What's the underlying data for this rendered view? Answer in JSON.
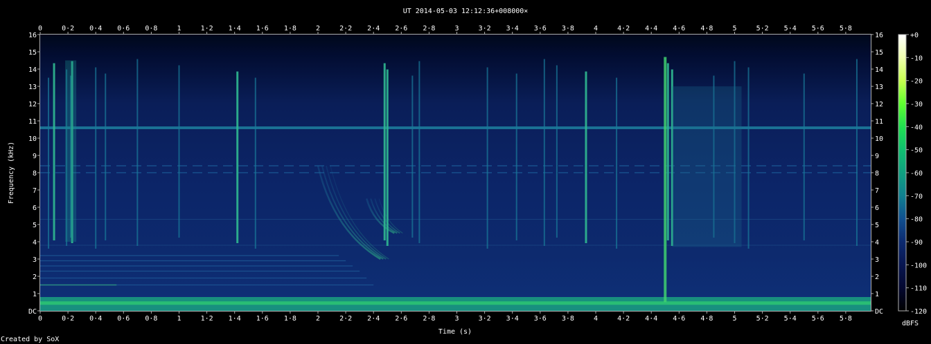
{
  "chart_data": {
    "type": "heatmap",
    "title": "UT 2014-05-03 12:12:36+008000×",
    "xlabel": "Time (s)",
    "ylabel": "Frequency (kHz)",
    "xlim": [
      0,
      5.98
    ],
    "ylim": [
      0,
      16
    ],
    "x_ticks": [
      "0",
      "0·2",
      "0·4",
      "0·6",
      "0·8",
      "1",
      "1·2",
      "1·4",
      "1·6",
      "1·8",
      "2",
      "2·2",
      "2·4",
      "2·6",
      "2·8",
      "3",
      "3·2",
      "3·4",
      "3·6",
      "3·8",
      "4",
      "4·2",
      "4·4",
      "4·6",
      "4·8",
      "5",
      "5·2",
      "5·4",
      "5·6",
      "5·8"
    ],
    "y_ticks": [
      "DC",
      "1",
      "2",
      "3",
      "4",
      "5",
      "6",
      "7",
      "8",
      "9",
      "10",
      "11",
      "12",
      "13",
      "14",
      "15",
      "16"
    ],
    "colorbar": {
      "label": "dBFS",
      "range": [
        -120,
        0
      ],
      "ticks": [
        "+0",
        "-10",
        "-20",
        "-30",
        "-40",
        "-50",
        "-60",
        "-70",
        "-80",
        "-90",
        "-100",
        "-110",
        "-120"
      ],
      "colors": [
        "#ffffff",
        "#f0ffb0",
        "#c8ff50",
        "#60ff30",
        "#20e050",
        "#10c070",
        "#10a080",
        "#108090",
        "#105090",
        "#0c2a70",
        "#081650",
        "#040830",
        "#000000"
      ]
    },
    "features": {
      "tone_khz": 10.6,
      "dashed_tones_khz": [
        8.0,
        8.4
      ],
      "low_band_khz": [
        0,
        0.8
      ],
      "impulses_s": [
        0.06,
        0.1,
        0.19,
        0.22,
        0.23,
        0.4,
        0.47,
        0.7,
        1.0,
        1.42,
        1.55,
        2.48,
        2.5,
        2.68,
        2.73,
        3.22,
        3.43,
        3.63,
        3.72,
        3.93,
        4.15,
        4.52,
        4.55,
        4.85,
        5.0,
        5.1,
        5.5,
        5.88
      ],
      "sweeps": [
        {
          "t_start": 2.0,
          "f_start_khz": 8.4,
          "t_end": 2.45,
          "f_end_khz": 3.0
        },
        {
          "t_start": 2.35,
          "f_start_khz": 6.5,
          "t_end": 2.55,
          "f_end_khz": 4.5
        }
      ]
    }
  },
  "footer": "Created by SoX",
  "colors": {
    "background": "#000000",
    "text": "#ffffff",
    "axis": "#b0b0b0"
  }
}
